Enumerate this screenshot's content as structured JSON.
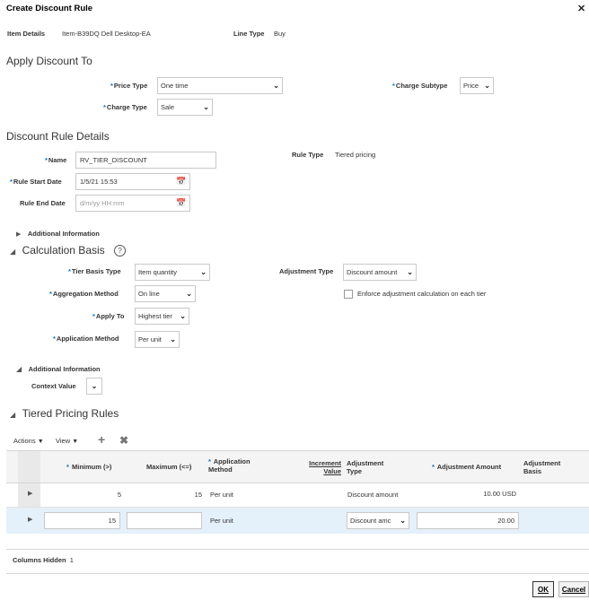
{
  "dialog": {
    "title": "Create Discount Rule",
    "close_icon": "close-icon"
  },
  "header": {
    "item_details_label": "Item Details",
    "item_details_value": "Item-B39DQ Dell Desktop-EA",
    "line_type_label": "Line Type",
    "line_type_value": "Buy"
  },
  "apply_discount": {
    "section_title": "Apply Discount To",
    "price_type_label": "Price Type",
    "price_type_value": "One time",
    "charge_subtype_label": "Charge Subtype",
    "charge_subtype_value": "Price",
    "charge_type_label": "Charge Type",
    "charge_type_value": "Sale"
  },
  "rule_details": {
    "section_title": "Discount Rule Details",
    "name_label": "Name",
    "name_value": "RV_TIER_DISCOUNT",
    "rule_type_label": "Rule Type",
    "rule_type_value": "Tiered pricing",
    "start_date_label": "Rule Start Date",
    "start_date_value": "1/5/21 15:53",
    "end_date_label": "Rule End Date",
    "end_date_placeholder": "d/m/yy HH:mm",
    "additional_info_label": "Additional Information"
  },
  "calculation_basis": {
    "section_title": "Calculation Basis",
    "help_glyph": "?",
    "tier_basis_type_label": "Tier Basis Type",
    "tier_basis_type_value": "Item quantity",
    "adjustment_type_label": "Adjustment Type",
    "adjustment_type_value": "Discount amount",
    "aggregation_method_label": "Aggregation Method",
    "aggregation_method_value": "On line",
    "enforce_label": "Enforce adjustment calculation on each tier",
    "apply_to_label": "Apply To",
    "apply_to_value": "Highest tier",
    "application_method_label": "Application Method",
    "application_method_value": "Per unit",
    "additional_info_label": "Additional Information",
    "context_value_label": "Context Value"
  },
  "tiered_rules": {
    "section_title": "Tiered Pricing Rules",
    "actions_label": "Actions",
    "view_label": "View",
    "add_icon": "plus-icon",
    "delete_icon": "x-icon",
    "columns": {
      "minimum": "Minimum (>)",
      "maximum": "Maximum (<=)",
      "application_method_1": "Application",
      "application_method_2": "Method",
      "increment_value_1": "Increment",
      "increment_value_2": "Value",
      "adjustment_type_1": "Adjustment",
      "adjustment_type_2": "Type",
      "adjustment_amount": "Adjustment Amount",
      "adjustment_basis_1": "Adjustment",
      "adjustment_basis_2": "Basis"
    },
    "rows": [
      {
        "minimum": "5",
        "maximum": "15",
        "application_method": "Per unit",
        "adjustment_type": "Discount amount",
        "adjustment_amount": "10.00 USD"
      },
      {
        "minimum": "15",
        "maximum": "",
        "application_method": "Per unit",
        "adjustment_type": "Discount amc",
        "adjustment_amount": "20.00"
      }
    ],
    "columns_hidden_label": "Columns Hidden",
    "columns_hidden_count": "1"
  },
  "footer": {
    "ok_label": "OK",
    "cancel_label": "Cancel"
  },
  "colors": {
    "required_asterisk": "#0572ce",
    "selected_row": "#e4f0fa",
    "table_header": "#f4f4f4"
  }
}
